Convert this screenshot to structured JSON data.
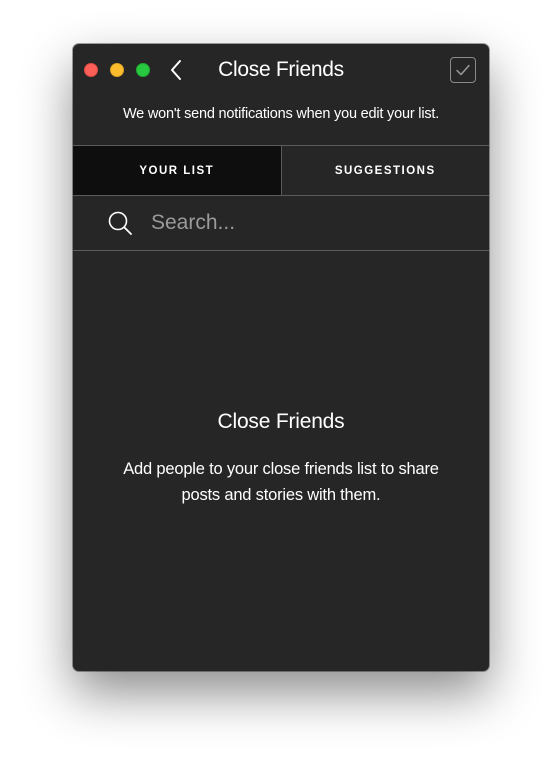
{
  "window": {
    "title": "Close Friends"
  },
  "header": {
    "notice": "We won't send notifications when you edit your list."
  },
  "tabs": [
    {
      "label": "YOUR LIST",
      "active": true
    },
    {
      "label": "SUGGESTIONS",
      "active": false
    }
  ],
  "search": {
    "placeholder": "Search...",
    "value": ""
  },
  "empty_state": {
    "title": "Close Friends",
    "description": "Add people to your close friends list to share posts and stories with them."
  },
  "icons": {
    "back": "chevron-left-icon",
    "done": "checkmark-icon",
    "search": "search-icon"
  },
  "colors": {
    "background": "#262626",
    "active_tab": "#0e0e0e",
    "divider": "#5a5a5a",
    "traffic_close": "#fc5f57",
    "traffic_minimize": "#fdbc2e",
    "traffic_maximize": "#28c840"
  }
}
